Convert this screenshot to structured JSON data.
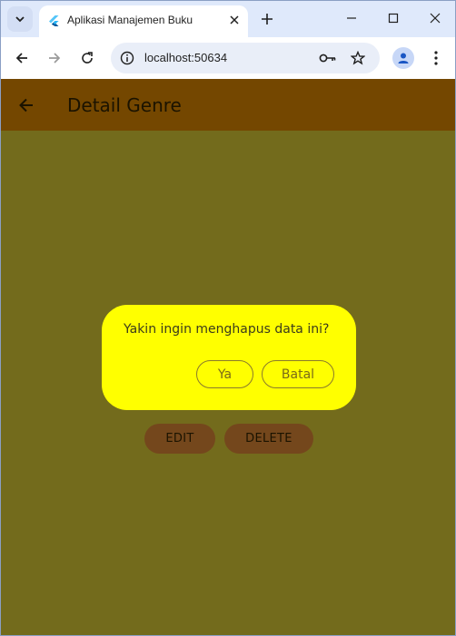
{
  "browser": {
    "tab_title": "Aplikasi Manajemen Buku",
    "url": "localhost:50634"
  },
  "app": {
    "title": "Detail Genre",
    "edit_label": "EDIT",
    "delete_label": "DELETE"
  },
  "dialog": {
    "message": "Yakin ingin menghapus data ini?",
    "yes_label": "Ya",
    "cancel_label": "Batal"
  },
  "colors": {
    "appbar": "#744700",
    "background": "#736b1c",
    "dialog": "#ffff00",
    "button": "#74471c"
  }
}
